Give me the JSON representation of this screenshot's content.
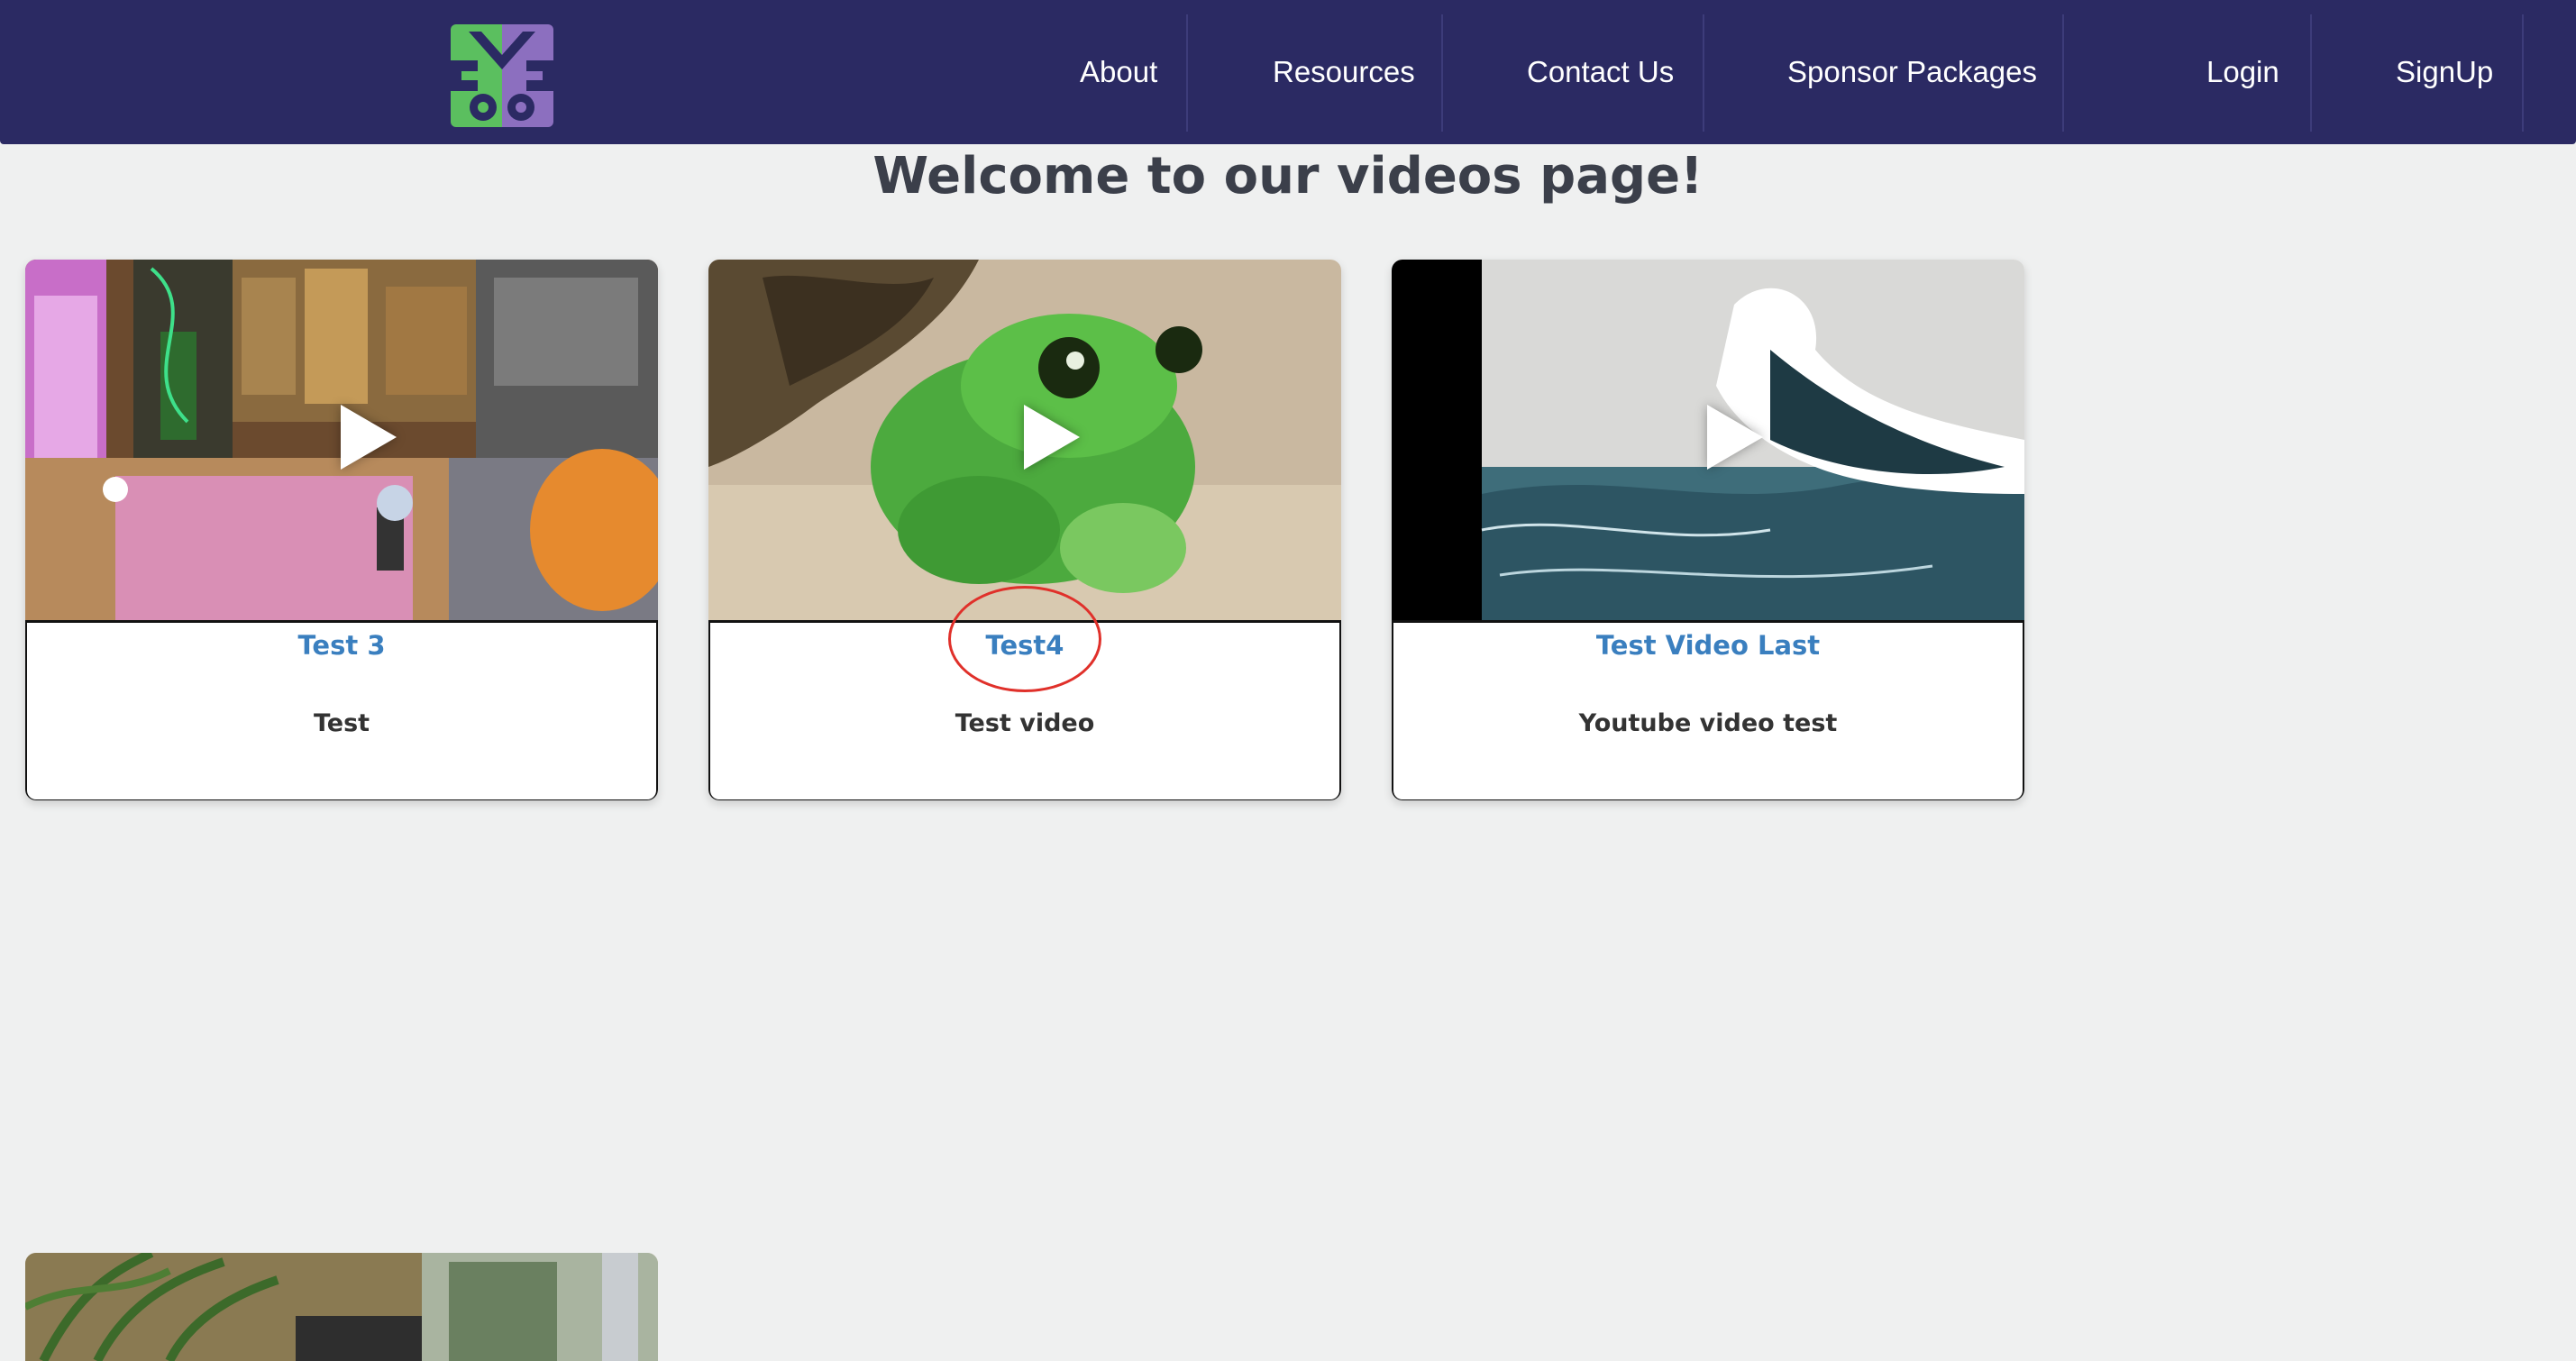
{
  "nav": {
    "items": [
      "About",
      "Resources",
      "Contact Us",
      "Sponsor Packages",
      "Login",
      "SignUp"
    ]
  },
  "page": {
    "title": "Welcome to our videos page!"
  },
  "videos": [
    {
      "title": "Test 3",
      "description": "Test"
    },
    {
      "title": "Test4",
      "description": "Test video"
    },
    {
      "title": "Test Video Last",
      "description": "Youtube video test"
    }
  ],
  "colors": {
    "navbar": "#2b2a63",
    "background": "#eff0f0",
    "link": "#3a7fbf",
    "annotation": "#e0302a"
  },
  "icons": [
    "logo-icon",
    "play-icon"
  ]
}
